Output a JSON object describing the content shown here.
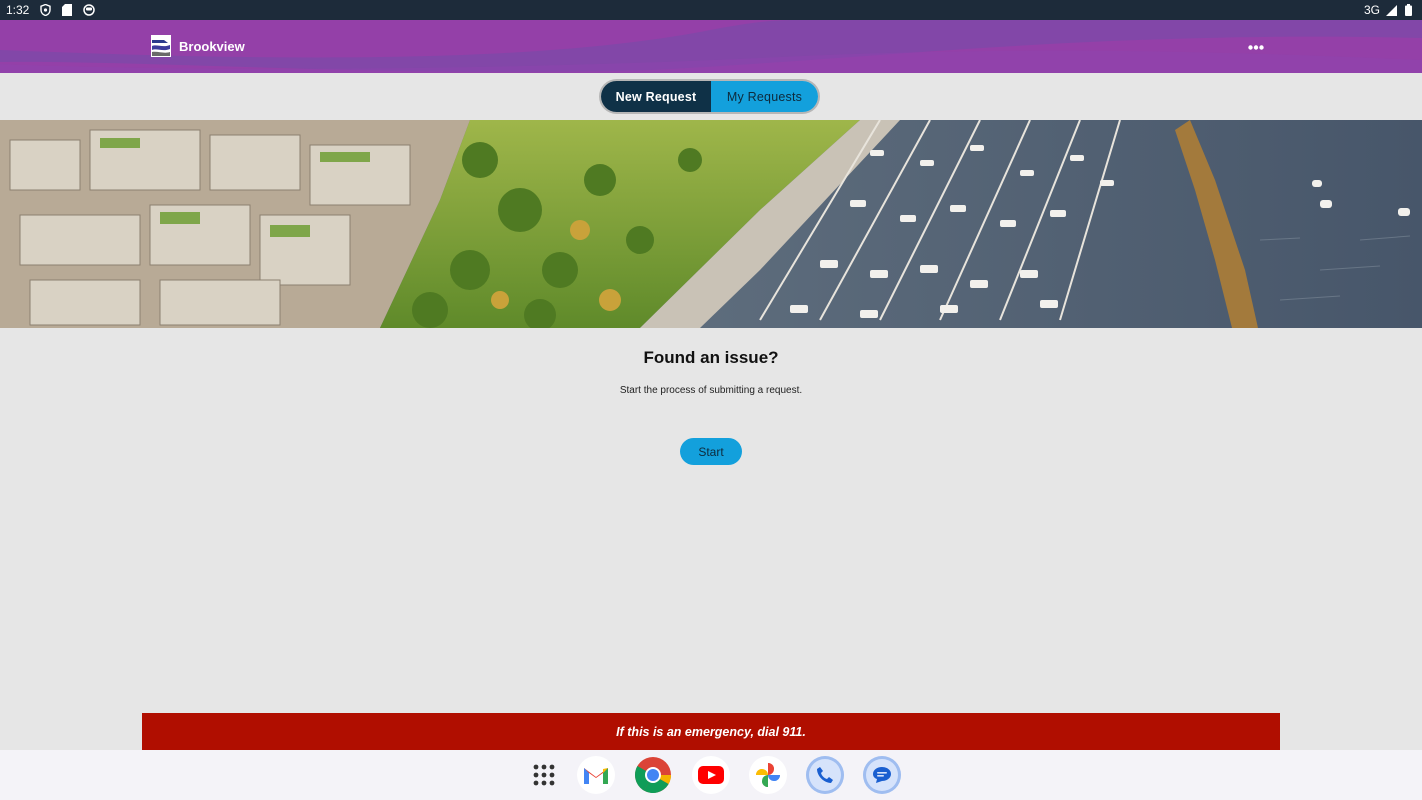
{
  "status_bar": {
    "time": "1:32",
    "network": "3G",
    "left_icons": [
      "shield-icon",
      "sd-card-icon",
      "smiley-icon"
    ],
    "right_icons": [
      "signal-icon",
      "battery-icon"
    ]
  },
  "header": {
    "app_name": "Brookview",
    "logo_icon": "brookview-logo-icon",
    "menu_icon": "more-horizontal-icon",
    "bg_color": "#9440a8"
  },
  "tabs": [
    {
      "label": "New Request",
      "active": true
    },
    {
      "label": "My Requests",
      "active": false
    }
  ],
  "hero": {
    "image": "waterfront-marina-aerial-photo"
  },
  "content": {
    "title": "Found an issue?",
    "subtitle": "Start the process of submitting a request.",
    "start_button": "Start"
  },
  "emergency": {
    "text": "If this is an emergency, dial 911.",
    "bg_color": "#b00e00"
  },
  "dock": {
    "apps": [
      "app-drawer-icon",
      "gmail-icon",
      "chrome-icon",
      "youtube-icon",
      "photos-icon",
      "phone-icon",
      "messages-icon"
    ]
  },
  "colors": {
    "accent": "#13a0dc",
    "active_tab": "#0f3147",
    "page_bg": "#e6e6e6"
  }
}
